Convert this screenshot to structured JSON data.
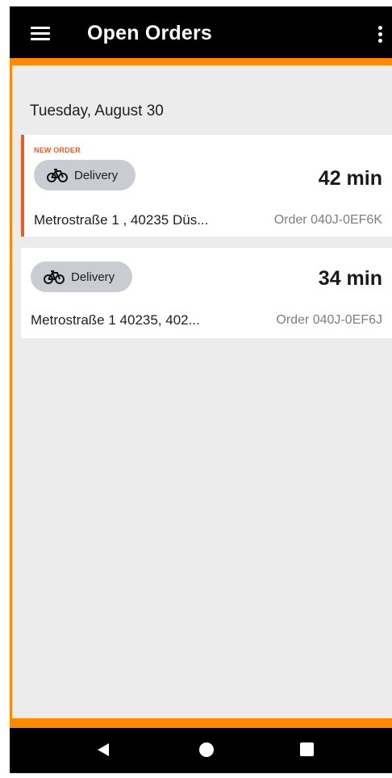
{
  "app_bar": {
    "title": "Open Orders",
    "menu_icon": "hamburger-menu-icon",
    "overflow_icon": "more-vertical-icon"
  },
  "colors": {
    "accent": "#ff8a00",
    "new_order": "#f05a24",
    "badge": "#c9ccd2"
  },
  "orders_section": {
    "date": "Tuesday, August 30"
  },
  "orders": [
    {
      "tag": "NEW ORDER",
      "type_label": "Delivery",
      "type_icon": "bicycle-icon",
      "time": "42 min",
      "address": "Metrostraße 1 , 40235 Düs...",
      "order_id": "Order 040J-0EF6K"
    },
    {
      "type_label": "Delivery",
      "type_icon": "bicycle-icon",
      "time": "34 min",
      "address": "Metrostraße 1 40235, 402...",
      "order_id": "Order 040J-0EF6J"
    }
  ],
  "system_nav": {
    "back_icon": "back-triangle-icon",
    "home_icon": "home-circle-icon",
    "recents_icon": "recents-square-icon"
  }
}
